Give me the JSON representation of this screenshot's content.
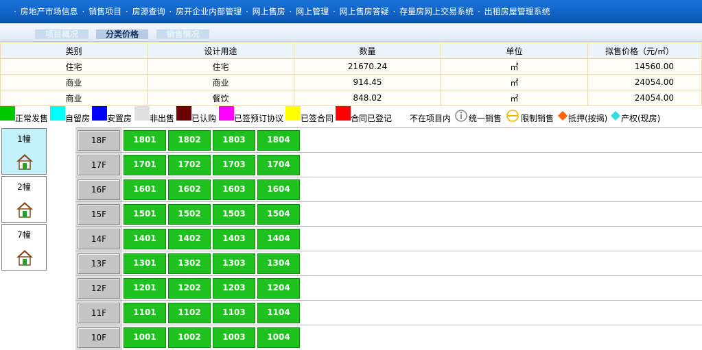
{
  "nav": {
    "items": [
      "房地产市场信息",
      "销售项目",
      "房源查询",
      "房开企业内部管理",
      "网上售房",
      "网上管理",
      "网上售房答疑",
      "存量房网上交易系统",
      "出租房屋管理系统"
    ],
    "separator": "·"
  },
  "tabs": [
    "项目概况",
    "分类价格",
    "销售情况"
  ],
  "price_table": {
    "headers": [
      "类别",
      "设计用途",
      "数量",
      "单位",
      "拟售价格（元/㎡）"
    ],
    "rows": [
      [
        "住宅",
        "住宅",
        "21670.24",
        "㎡",
        "14560.00"
      ],
      [
        "商业",
        "商业",
        "914.45",
        "㎡",
        "24054.00"
      ],
      [
        "商业",
        "餐饮",
        "848.02",
        "㎡",
        "24054.00"
      ]
    ]
  },
  "legend": [
    {
      "label": "正常发售",
      "color": "#00c800",
      "kind": "swatch"
    },
    {
      "label": "自留房",
      "color": "#00ffff",
      "kind": "swatch"
    },
    {
      "label": "安置房",
      "color": "#0000ff",
      "kind": "swatch"
    },
    {
      "label": "非出售",
      "color": "#e0e0e0",
      "kind": "swatch"
    },
    {
      "label": "已认购",
      "color": "#6a0000",
      "kind": "swatch"
    },
    {
      "label": "已签预订协议",
      "color": "#ff00ff",
      "kind": "swatch"
    },
    {
      "label": "已签合同",
      "color": "#ffff00",
      "kind": "swatch"
    },
    {
      "label": "合同已登记",
      "color": "#ff0000",
      "kind": "swatch"
    },
    {
      "label": "不在项目内",
      "color": "#ffffff",
      "kind": "swatch"
    },
    {
      "label": "统一销售",
      "color": "#888888",
      "kind": "info-icon"
    },
    {
      "label": "限制销售",
      "color": "#e6b800",
      "kind": "minus-circle-icon"
    },
    {
      "label": "抵押(按揭)",
      "color": "#ff6600",
      "kind": "diamond-icon"
    },
    {
      "label": "产权(现房)",
      "color": "#33dddd",
      "kind": "diamond-icon"
    }
  ],
  "buildings": [
    {
      "label": "1幢",
      "active": true
    },
    {
      "label": "2幢",
      "active": false
    },
    {
      "label": "7幢",
      "active": false
    }
  ],
  "floors": [
    {
      "floor": "18F",
      "units": [
        "1801",
        "1802",
        "1803",
        "1804"
      ]
    },
    {
      "floor": "17F",
      "units": [
        "1701",
        "1702",
        "1703",
        "1704"
      ]
    },
    {
      "floor": "16F",
      "units": [
        "1601",
        "1602",
        "1603",
        "1604"
      ]
    },
    {
      "floor": "15F",
      "units": [
        "1501",
        "1502",
        "1503",
        "1504"
      ]
    },
    {
      "floor": "14F",
      "units": [
        "1401",
        "1402",
        "1403",
        "1404"
      ]
    },
    {
      "floor": "13F",
      "units": [
        "1301",
        "1302",
        "1303",
        "1304"
      ]
    },
    {
      "floor": "12F",
      "units": [
        "1201",
        "1202",
        "1203",
        "1204"
      ]
    },
    {
      "floor": "11F",
      "units": [
        "1101",
        "1102",
        "1103",
        "1104"
      ]
    },
    {
      "floor": "10F",
      "units": [
        "1001",
        "1002",
        "1003",
        "1004"
      ]
    }
  ]
}
